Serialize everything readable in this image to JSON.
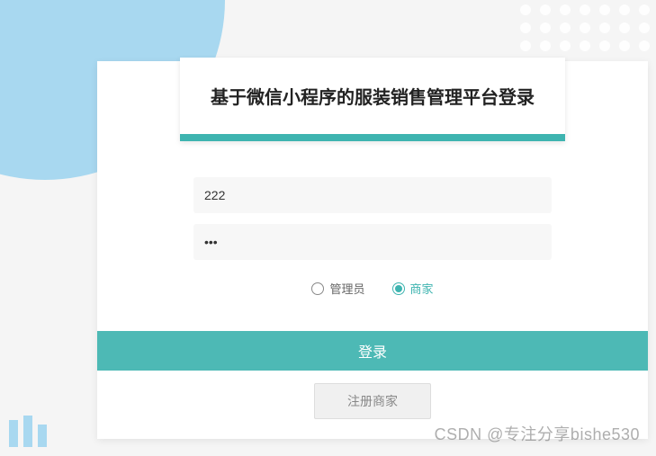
{
  "title": "基于微信小程序的服装销售管理平台登录",
  "form": {
    "username_value": "222",
    "password_value": "•••",
    "roles": {
      "admin": "管理员",
      "merchant": "商家"
    },
    "login_label": "登录",
    "register_label": "注册商家"
  },
  "watermark": "CSDN @专注分享bishe530"
}
